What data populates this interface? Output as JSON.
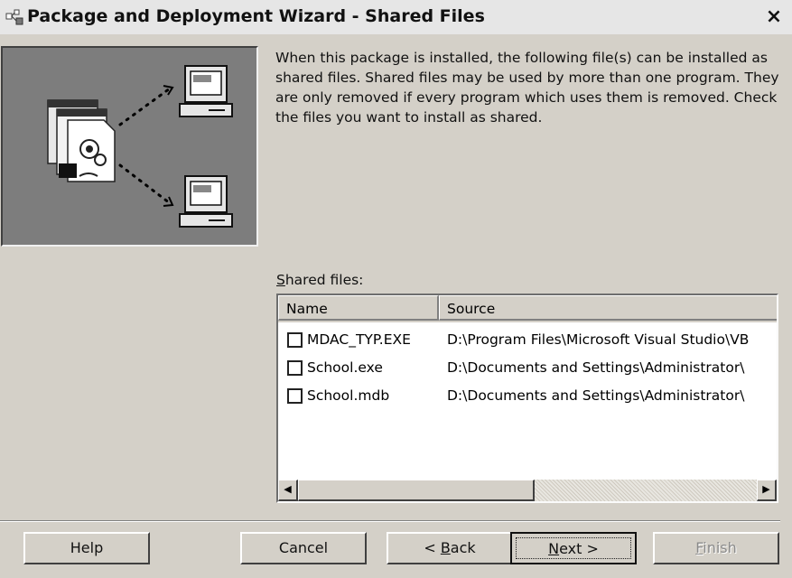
{
  "window": {
    "title": "Package and Deployment Wizard - Shared Files",
    "close_label": "×"
  },
  "description": "When this package is installed, the following file(s) can be installed as shared files. Shared files may be used by more than one program. They are only removed if every program which uses them is removed. Check the files you want to install as shared.",
  "list": {
    "label_prefix": "S",
    "label_rest": "hared files:",
    "columns": {
      "name": "Name",
      "source": "Source"
    },
    "rows": [
      {
        "name": "MDAC_TYP.EXE",
        "source": "D:\\Program Files\\Microsoft Visual Studio\\VB",
        "checked": false
      },
      {
        "name": "School.exe",
        "source": "D:\\Documents and Settings\\Administrator\\",
        "checked": false
      },
      {
        "name": "School.mdb",
        "source": "D:\\Documents and Settings\\Administrator\\",
        "checked": false
      }
    ]
  },
  "buttons": {
    "help": "Help",
    "cancel": "Cancel",
    "back_prefix": "< ",
    "back_mnemonic": "B",
    "back_rest": "ack",
    "next_mnemonic": "N",
    "next_rest": "ext >",
    "finish_mnemonic": "F",
    "finish_rest": "inish"
  },
  "icons": {
    "window": "wizard-app-icon",
    "illustration": "package-deploy-illustration"
  }
}
